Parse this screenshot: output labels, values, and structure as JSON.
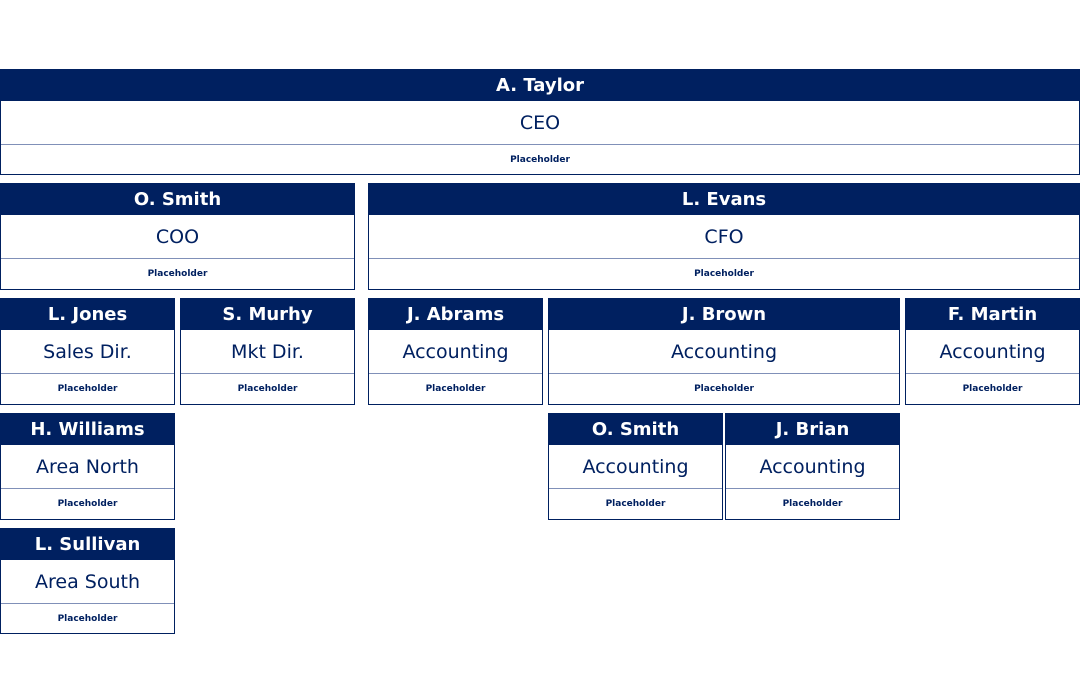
{
  "colors": {
    "header": "#002060",
    "text": "#002060"
  },
  "cards": [
    {
      "name": "A. Taylor",
      "role": "CEO",
      "note": "Placeholder"
    },
    {
      "name": "O. Smith",
      "role": "COO",
      "note": "Placeholder"
    },
    {
      "name": "L. Evans",
      "role": "CFO",
      "note": "Placeholder"
    },
    {
      "name": "L. Jones",
      "role": "Sales Dir.",
      "note": "Placeholder"
    },
    {
      "name": "S. Murhy",
      "role": "Mkt Dir.",
      "note": "Placeholder"
    },
    {
      "name": "J. Abrams",
      "role": "Accounting",
      "note": "Placeholder"
    },
    {
      "name": "J. Brown",
      "role": "Accounting",
      "note": "Placeholder"
    },
    {
      "name": "F. Martin",
      "role": "Accounting",
      "note": "Placeholder"
    },
    {
      "name": "H. Williams",
      "role": "Area North",
      "note": "Placeholder"
    },
    {
      "name": "O. Smith",
      "role": "Accounting",
      "note": "Placeholder"
    },
    {
      "name": "J. Brian",
      "role": "Accounting",
      "note": "Placeholder"
    },
    {
      "name": "L. Sullivan",
      "role": "Area South",
      "note": "Placeholder"
    }
  ]
}
